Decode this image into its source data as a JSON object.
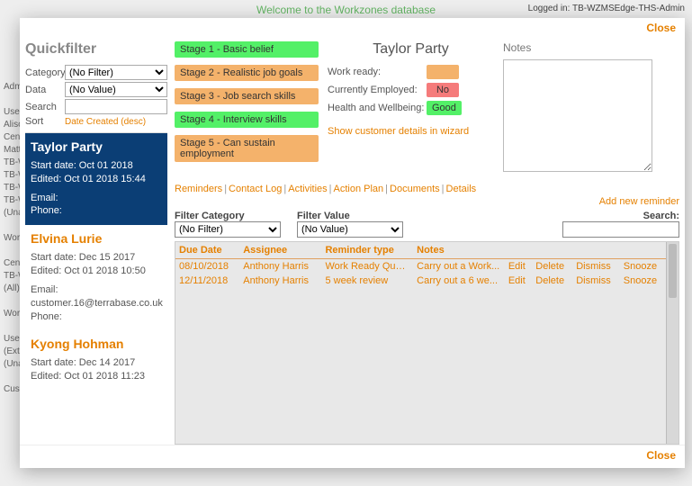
{
  "bg": {
    "welcome": "Welcome to the Workzones database",
    "logged_in": "Logged in: TB-WZMSEdge-THS-Admin",
    "left_lines": [
      "Adm",
      "",
      "User",
      "Aliso",
      "Centr",
      "Matt/",
      "TB-W",
      "TB-W",
      "TB-W",
      "TB-W",
      "(Una",
      "",
      "Wor",
      "",
      "Centr",
      "TB-W",
      "(All)",
      "",
      "Wor",
      "",
      "User",
      "(Ext.",
      "(Una",
      "",
      "Cust"
    ]
  },
  "modal": {
    "close": "Close"
  },
  "quickfilter": {
    "title": "Quickfilter",
    "labels": {
      "category": "Category",
      "data": "Data",
      "search": "Search",
      "sort": "Sort"
    },
    "category": "(No Filter)",
    "data": "(No Value)",
    "search": "",
    "sort_value": "Date Created (desc)"
  },
  "people": [
    {
      "name": "Taylor Party",
      "start": "Start date: Oct 01 2018",
      "edited": "Edited: Oct 01 2018 15:44",
      "email": "Email:",
      "phone": "Phone:",
      "selected": true
    },
    {
      "name": "Elvina Lurie",
      "start": "Start date: Dec 15 2017",
      "edited": "Edited: Oct 01 2018 10:50",
      "email": "Email: customer.16@terrabase.co.uk",
      "phone": "Phone:",
      "selected": false
    },
    {
      "name": "Kyong Hohman",
      "start": "Start date: Dec 14 2017",
      "edited": "Edited: Oct 01 2018 11:23",
      "email": "",
      "phone": "",
      "selected": false
    }
  ],
  "stages": [
    {
      "label": "Stage 1 - Basic belief",
      "cls": "green"
    },
    {
      "label": "Stage 2 - Realistic job goals",
      "cls": "orange"
    },
    {
      "label": "Stage 3 - Job search skills",
      "cls": "orange"
    },
    {
      "label": "Stage 4 - Interview skills",
      "cls": "green"
    },
    {
      "label": "Stage 5 - Can sustain employment",
      "cls": "orange"
    }
  ],
  "customer": {
    "title": "Taylor Party",
    "rows": {
      "work_ready_lbl": "Work ready:",
      "employed_lbl": "Currently Employed:",
      "employed_val": "No",
      "health_lbl": "Health and Wellbeing:",
      "health_val": "Good"
    },
    "wizard": "Show customer details in wizard"
  },
  "notes": {
    "label": "Notes",
    "value": ""
  },
  "tabs": {
    "items": [
      "Reminders",
      "Contact Log",
      "Activities",
      "Action Plan",
      "Documents",
      "Details"
    ],
    "add": "Add new reminder"
  },
  "filterbar": {
    "cat_label": "Filter Category",
    "cat_value": "(No Filter)",
    "val_label": "Filter Value",
    "val_value": "(No Value)",
    "search_label": "Search:",
    "search_value": ""
  },
  "grid": {
    "headers": [
      "Due Date",
      "Assignee",
      "Reminder type",
      "Notes",
      "",
      "",
      "",
      ""
    ],
    "rows": [
      {
        "due": "08/10/2018",
        "assignee": "Anthony Harris",
        "type": "Work Ready Questio...",
        "notes": "Carry out a Work...",
        "a1": "Edit",
        "a2": "Delete",
        "a3": "Dismiss",
        "a4": "Snooze"
      },
      {
        "due": "12/11/2018",
        "assignee": "Anthony Harris",
        "type": "5 week review",
        "notes": "Carry out a 6 we...",
        "a1": "Edit",
        "a2": "Delete",
        "a3": "Dismiss",
        "a4": "Snooze"
      }
    ]
  }
}
